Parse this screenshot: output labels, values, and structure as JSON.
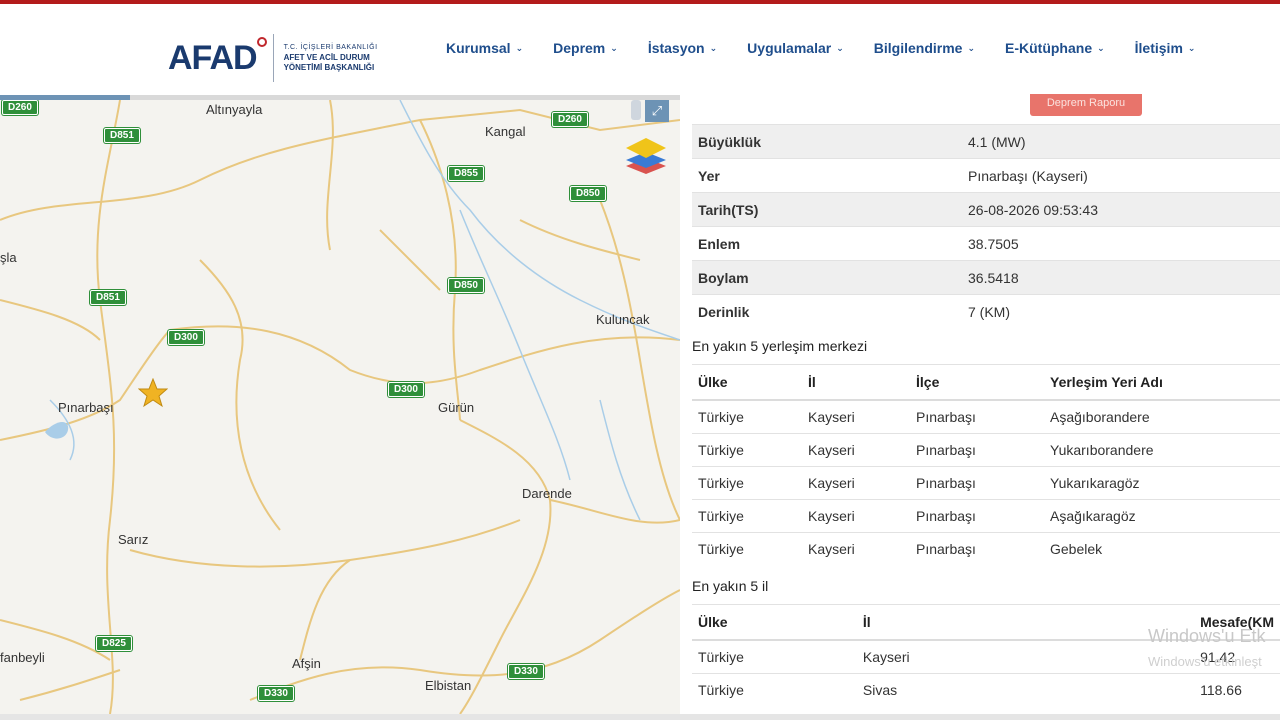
{
  "header": {
    "logo": "AFAD",
    "logo_sub": [
      "T.C. İÇİŞLERİ BAKANLIĞI",
      "AFET VE ACİL DURUM",
      "YÖNETİMİ BAŞKANLIĞI"
    ],
    "nav": [
      "Kurumsal",
      "Deprem",
      "İstasyon",
      "Uygulamalar",
      "Bilgilendirme",
      "E-Kütüphane",
      "İletişim"
    ]
  },
  "map": {
    "places": [
      "Altınyayla",
      "Kangal",
      "şla",
      "Kuluncak",
      "Pınarbaşı",
      "Gürün",
      "Darende",
      "Sarız",
      "fanbeyli",
      "Afşin",
      "Elbistan"
    ],
    "roads": [
      "D260",
      "D851",
      "D260",
      "D855",
      "D850",
      "D851",
      "D850",
      "D300",
      "D300",
      "D825",
      "D330",
      "D330"
    ],
    "marker_icon": "star-icon",
    "colors": {
      "road": "#e8c77f",
      "water": "#a9cde8",
      "marker": "#f0b323"
    }
  },
  "report_button": "Deprem Raporu",
  "details": [
    {
      "key": "Büyüklük",
      "value": "4.1 (MW)"
    },
    {
      "key": "Yer",
      "value": "Pınarbaşı (Kayseri)"
    },
    {
      "key": "Tarih(TS)",
      "value": "26-08-2026 09:53:43"
    },
    {
      "key": "Enlem",
      "value": "38.7505"
    },
    {
      "key": "Boylam",
      "value": "36.5418"
    },
    {
      "key": "Derinlik",
      "value": "7 (KM)"
    }
  ],
  "settlements": {
    "title": "En yakın 5 yerleşim merkezi",
    "headers": [
      "Ülke",
      "İl",
      "İlçe",
      "Yerleşim Yeri Adı"
    ],
    "rows": [
      [
        "Türkiye",
        "Kayseri",
        "Pınarbaşı",
        "Aşağıborandere"
      ],
      [
        "Türkiye",
        "Kayseri",
        "Pınarbaşı",
        "Yukarıborandere"
      ],
      [
        "Türkiye",
        "Kayseri",
        "Pınarbaşı",
        "Yukarıkaragöz"
      ],
      [
        "Türkiye",
        "Kayseri",
        "Pınarbaşı",
        "Aşağıkaragöz"
      ],
      [
        "Türkiye",
        "Kayseri",
        "Pınarbaşı",
        "Gebelek"
      ]
    ]
  },
  "provinces": {
    "title": "En yakın 5 il",
    "headers": [
      "Ülke",
      "İl",
      "Mesafe(KM"
    ],
    "rows": [
      [
        "Türkiye",
        "Kayseri",
        "91.42"
      ],
      [
        "Türkiye",
        "Sivas",
        "118.66"
      ]
    ]
  },
  "watermark": [
    "Windows'u Etk",
    "Windows'u etkinleşt"
  ],
  "brand_colors": {
    "primary": "#1a3a6e",
    "accent": "#c0272d",
    "button": "#e8746b"
  }
}
